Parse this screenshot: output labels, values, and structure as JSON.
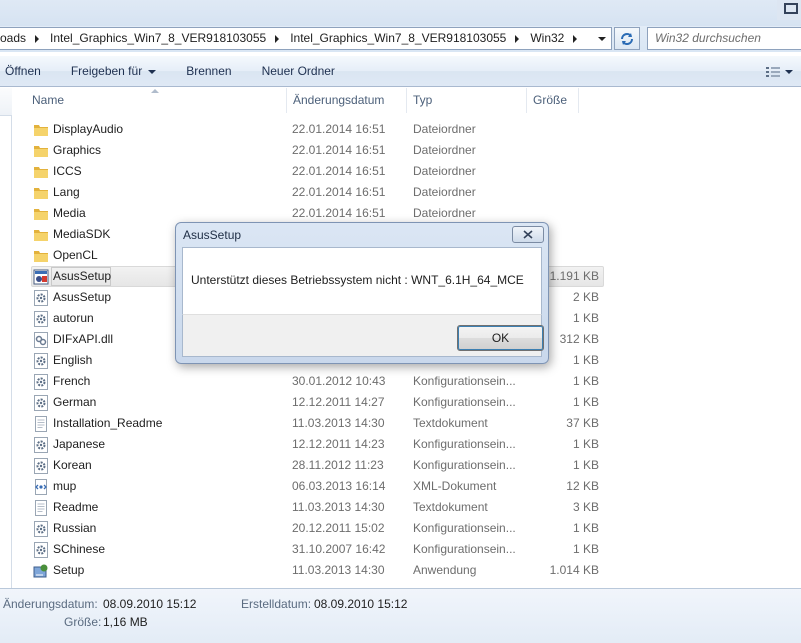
{
  "address": {
    "crumbs": [
      "oads",
      "Intel_Graphics_Win7_8_VER918103055",
      "Intel_Graphics_Win7_8_VER918103055",
      "Win32"
    ],
    "search_placeholder": "Win32 durchsuchen"
  },
  "toolbar": {
    "open": "Öffnen",
    "share": "Freigeben für",
    "burn": "Brennen",
    "new_folder": "Neuer Ordner"
  },
  "columns": {
    "name": "Name",
    "date": "Änderungsdatum",
    "type": "Typ",
    "size": "Größe"
  },
  "files": [
    {
      "name": "DisplayAudio",
      "date": "22.01.2014 16:51",
      "type": "Dateiordner",
      "size": "",
      "icon": "folder-icon"
    },
    {
      "name": "Graphics",
      "date": "22.01.2014 16:51",
      "type": "Dateiordner",
      "size": "",
      "icon": "folder-icon"
    },
    {
      "name": "ICCS",
      "date": "22.01.2014 16:51",
      "type": "Dateiordner",
      "size": "",
      "icon": "folder-icon"
    },
    {
      "name": "Lang",
      "date": "22.01.2014 16:51",
      "type": "Dateiordner",
      "size": "",
      "icon": "folder-icon"
    },
    {
      "name": "Media",
      "date": "22.01.2014 16:51",
      "type": "Dateiordner",
      "size": "",
      "icon": "folder-icon"
    },
    {
      "name": "MediaSDK",
      "date": "",
      "type": "",
      "size": "",
      "icon": "folder-icon"
    },
    {
      "name": "OpenCL",
      "date": "",
      "type": "",
      "size": "",
      "icon": "folder-icon"
    },
    {
      "name": "AsusSetup",
      "date": "",
      "type": "",
      "size": "1.191 KB",
      "icon": "setup-exe-icon",
      "selected": true
    },
    {
      "name": "AsusSetup",
      "date": "",
      "type": "",
      "size": "2 KB",
      "icon": "config-gear-icon"
    },
    {
      "name": "autorun",
      "date": "",
      "type": "",
      "size": "1 KB",
      "icon": "config-gear-icon"
    },
    {
      "name": "DIFxAPI.dll",
      "date": "",
      "type": "",
      "size": "312 KB",
      "icon": "dll-icon"
    },
    {
      "name": "English",
      "date": "",
      "type": "",
      "size": "1 KB",
      "icon": "config-gear-icon"
    },
    {
      "name": "French",
      "date": "30.01.2012 10:43",
      "type": "Konfigurationsein...",
      "size": "1 KB",
      "icon": "config-gear-icon"
    },
    {
      "name": "German",
      "date": "12.12.2011 14:27",
      "type": "Konfigurationsein...",
      "size": "1 KB",
      "icon": "config-gear-icon"
    },
    {
      "name": "Installation_Readme",
      "date": "11.03.2013 14:30",
      "type": "Textdokument",
      "size": "37 KB",
      "icon": "text-document-icon"
    },
    {
      "name": "Japanese",
      "date": "12.12.2011 14:23",
      "type": "Konfigurationsein...",
      "size": "1 KB",
      "icon": "config-gear-icon"
    },
    {
      "name": "Korean",
      "date": "28.11.2012 11:23",
      "type": "Konfigurationsein...",
      "size": "1 KB",
      "icon": "config-gear-icon"
    },
    {
      "name": "mup",
      "date": "06.03.2013 16:14",
      "type": "XML-Dokument",
      "size": "12 KB",
      "icon": "xml-document-icon"
    },
    {
      "name": "Readme",
      "date": "11.03.2013 14:30",
      "type": "Textdokument",
      "size": "3 KB",
      "icon": "text-document-icon"
    },
    {
      "name": "Russian",
      "date": "20.12.2011 15:02",
      "type": "Konfigurationsein...",
      "size": "1 KB",
      "icon": "config-gear-icon"
    },
    {
      "name": "SChinese",
      "date": "31.10.2007 16:42",
      "type": "Konfigurationsein...",
      "size": "1 KB",
      "icon": "config-gear-icon"
    },
    {
      "name": "Setup",
      "date": "11.03.2013 14:30",
      "type": "Anwendung",
      "size": "1.014 KB",
      "icon": "application-icon"
    }
  ],
  "details": {
    "modified_label": "Änderungsdatum:",
    "modified_value": "08.09.2010 15:12",
    "created_label": "Erstelldatum:",
    "created_value": "08.09.2010 15:12",
    "size_label": "Größe:",
    "size_value": "1,16 MB"
  },
  "dialog": {
    "title": "AsusSetup",
    "message": "Unterstützt dieses Betriebssystem nicht : WNT_6.1H_64_MCE",
    "ok_label": "OK"
  },
  "colors": {
    "folder": "#f2c94c",
    "selection": "#e8e8e8",
    "dialog_frame": "#c9d8ec",
    "accent": "#3c7fb1"
  }
}
